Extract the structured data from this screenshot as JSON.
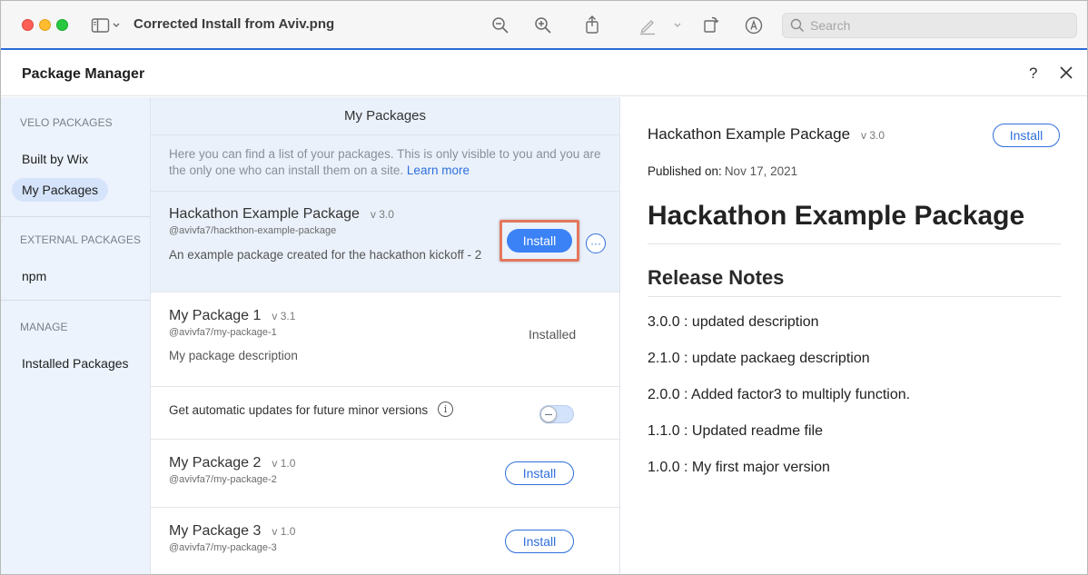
{
  "window": {
    "title": "Corrected Install from Aviv.png",
    "search_placeholder": "Search"
  },
  "panel": {
    "title": "Package Manager",
    "help_label": "?"
  },
  "sidebar": {
    "sections": [
      {
        "title": "VELO PACKAGES",
        "items": [
          "Built by Wix",
          "My Packages"
        ]
      },
      {
        "title": "EXTERNAL PACKAGES",
        "items": [
          "npm"
        ]
      },
      {
        "title": "MANAGE",
        "items": [
          "Installed Packages"
        ]
      }
    ],
    "active_item": "My Packages"
  },
  "list": {
    "heading": "My Packages",
    "intro": "Here you can find a list of your packages. This is only visible to you and you are the only one who can install them on a site.",
    "learn_more": "Learn more",
    "packages": [
      {
        "name": "Hackathon Example Package",
        "version": "v 3.0",
        "id": "@avivfa7/hackthon-example-package",
        "description": "An example package created for the hackathon kickoff - 2",
        "action": "Install",
        "more": "···"
      },
      {
        "name": "My Package 1",
        "version": "v 3.1",
        "id": "@avivfa7/my-package-1",
        "description": "My package description",
        "status": "Installed"
      },
      {
        "name": "My Package 2",
        "version": "v 1.0",
        "id": "@avivfa7/my-package-2",
        "action": "Install"
      },
      {
        "name": "My Package 3",
        "version": "v 1.0",
        "id": "@avivfa7/my-package-3",
        "action": "Install"
      }
    ],
    "auto_update": {
      "label": "Get automatic updates for future minor versions",
      "enabled": false,
      "info": "i"
    }
  },
  "detail": {
    "name": "Hackathon Example Package",
    "version": "v 3.0",
    "install_label": "Install",
    "published_label": "Published on:",
    "published_date": "Nov 17, 2021",
    "title": "Hackathon Example Package",
    "release_heading": "Release Notes",
    "notes": [
      "3.0.0 : updated description",
      "2.1.0 : update packaeg description",
      "2.0.0 : Added factor3 to multiply function.",
      "1.1.0 : Updated readme file",
      "1.0.0 : My first major version"
    ]
  },
  "colors": {
    "accent": "#3b82f6",
    "link": "#2f6fdb",
    "highlight": "#e4775d",
    "sidebar_bg": "#ecf3fd"
  }
}
